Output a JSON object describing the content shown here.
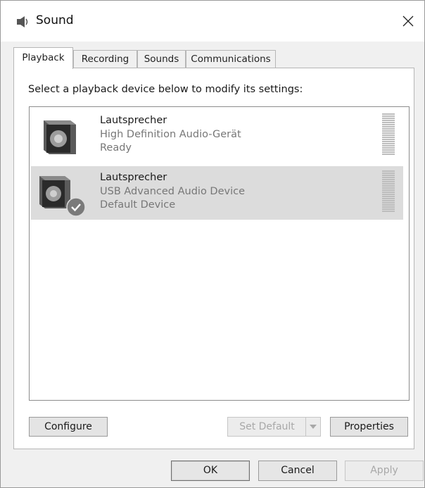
{
  "window": {
    "title": "Sound"
  },
  "tabs": [
    {
      "label": "Playback",
      "active": true
    },
    {
      "label": "Recording",
      "active": false
    },
    {
      "label": "Sounds",
      "active": false
    },
    {
      "label": "Communications",
      "active": false
    }
  ],
  "playback": {
    "instruction": "Select a playback device below to modify its settings:",
    "devices": [
      {
        "name": "Lautsprecher",
        "description": "High Definition Audio-Gerät",
        "status": "Ready",
        "selected": false,
        "default": false
      },
      {
        "name": "Lautsprecher",
        "description": "USB Advanced Audio Device",
        "status": "Default Device",
        "selected": true,
        "default": true
      }
    ],
    "buttons": {
      "configure": "Configure",
      "set_default": "Set Default",
      "properties": "Properties"
    }
  },
  "dialog_buttons": {
    "ok": "OK",
    "cancel": "Cancel",
    "apply": "Apply"
  },
  "icons": {
    "title": "speaker-icon",
    "close": "close-icon",
    "device": "speaker-icon",
    "default_badge": "check-badge-icon",
    "dropdown": "chevron-down-icon"
  },
  "colors": {
    "selected_row": "#dcdcdc",
    "disabled_text": "#a8a8a8",
    "secondary_text": "#777777"
  }
}
